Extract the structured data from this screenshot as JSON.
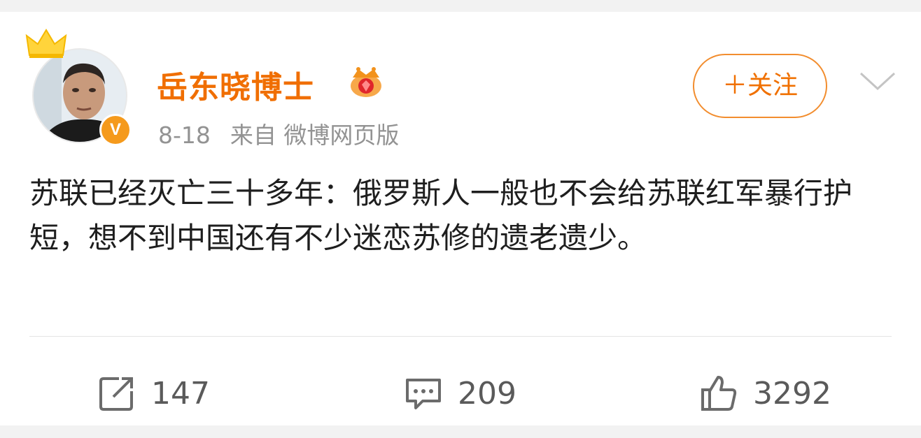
{
  "post": {
    "author": {
      "name": "岳东晓博士",
      "verified": true
    },
    "meta": {
      "date": "8-18",
      "source": "来自 微博网页版"
    },
    "follow_label": "＋关注",
    "text": "苏联已经灭亡三十多年：俄罗斯人一般也不会给苏联红军暴行护短，想不到中国还有不少迷恋苏修的遗老遗少。",
    "actions": {
      "repost_count": "147",
      "comment_count": "209",
      "like_count": "3292"
    },
    "colors": {
      "accent": "#f06e00",
      "meta": "#939393",
      "text": "#1e1e1e"
    }
  }
}
